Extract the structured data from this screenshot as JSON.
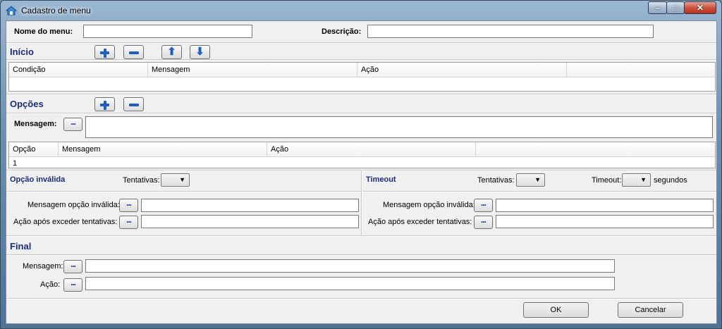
{
  "window": {
    "title": "Cadastro de menu"
  },
  "header": {
    "nome_label": "Nome do  menu:",
    "nome_value": "",
    "descricao_label": "Descrição:",
    "descricao_value": ""
  },
  "inicio": {
    "title": "Início",
    "columns": [
      "Condição",
      "Mensagem",
      "Ação"
    ]
  },
  "opcoes": {
    "title": "Opções",
    "mensagem_label": "Mensagem:",
    "columns": [
      "Opção",
      "Mensagem",
      "Ação"
    ],
    "rows": [
      {
        "opcao": "1"
      }
    ]
  },
  "opcao_invalida": {
    "title": "Opção inválida",
    "tentativas_label": "Tentativas:",
    "msg_label": "Mensagem opção inválida:",
    "acao_label": "Ação após exceder tentativas:"
  },
  "timeout": {
    "title": "Timeout",
    "tentativas_label": "Tentativas:",
    "timeout_label": "Timeout:",
    "segundos_label": "segundos",
    "msg_label": "Mensagem opção inválida:",
    "acao_label": "Ação após exceder tentativas:"
  },
  "final": {
    "title": "Final",
    "mensagem_label": "Mensagem:",
    "acao_label": "Ação:"
  },
  "buttons": {
    "ok": "OK",
    "cancelar": "Cancelar",
    "dots": "..."
  },
  "colors": {
    "section_title": "#1e2a78",
    "icon_blue": "#1f5fc2"
  }
}
